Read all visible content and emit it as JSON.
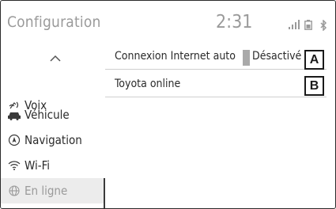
{
  "header": {
    "title": "Configuration",
    "clock": "2:31",
    "icons": [
      "signal-icon",
      "battery-icon",
      "bluetooth-icon"
    ]
  },
  "sidebar": {
    "items": [
      {
        "label": "Voix",
        "icon": "voice-icon"
      },
      {
        "label": "Véhicule",
        "icon": "car-icon"
      },
      {
        "label": "Navigation",
        "icon": "compass-icon"
      },
      {
        "label": "Wi-Fi",
        "icon": "wifi-icon"
      },
      {
        "label": "En ligne",
        "icon": "globe-icon",
        "active": true
      }
    ]
  },
  "settings": {
    "rows": [
      {
        "label": "Connexion Internet auto",
        "value": "Désactivé",
        "callout": "A"
      },
      {
        "label": "Toyota online",
        "callout": "B"
      }
    ]
  },
  "colors": {
    "text": "#2b2b2b",
    "muted": "#9a9a9a",
    "active_bg": "#ececec",
    "toggle_off": "#a9a9a9"
  }
}
